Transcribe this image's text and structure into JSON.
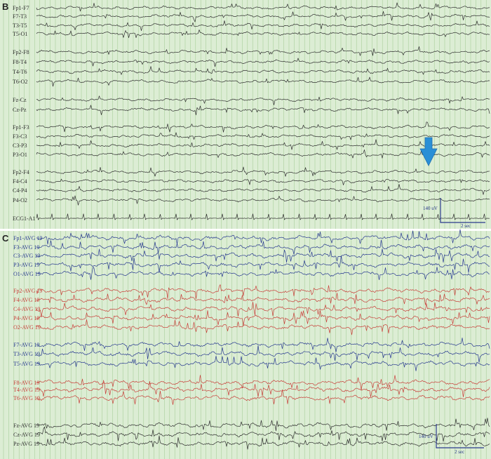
{
  "panels": [
    {
      "letter": "B",
      "channels": [
        {
          "label": "Fp1-F7",
          "color": "#2f2f2f"
        },
        {
          "label": "F7-T3",
          "color": "#2f2f2f"
        },
        {
          "label": "T3-T5",
          "color": "#2f2f2f"
        },
        {
          "label": "T5-O1",
          "color": "#2f2f2f"
        },
        {
          "label": "Fp2-F8",
          "color": "#2f2f2f"
        },
        {
          "label": "F8-T4",
          "color": "#2f2f2f"
        },
        {
          "label": "T4-T6",
          "color": "#2f2f2f"
        },
        {
          "label": "T6-O2",
          "color": "#2f2f2f"
        },
        {
          "label": "Fz-Cz",
          "color": "#2f2f2f"
        },
        {
          "label": "Cz-Pz",
          "color": "#2f2f2f"
        },
        {
          "label": "Fp1-F3",
          "color": "#2f2f2f"
        },
        {
          "label": "F3-C3",
          "color": "#2f2f2f"
        },
        {
          "label": "C3-P3",
          "color": "#2f2f2f"
        },
        {
          "label": "P3-O1",
          "color": "#2f2f2f"
        },
        {
          "label": "Fp2-F4",
          "color": "#2f2f2f"
        },
        {
          "label": "F4-C4",
          "color": "#2f2f2f"
        },
        {
          "label": "C4-P4",
          "color": "#2f2f2f"
        },
        {
          "label": "P4-O2",
          "color": "#2f2f2f"
        },
        {
          "label": "ECG1-A1",
          "color": "#2f2f2f"
        }
      ],
      "scale": {
        "amplitude": "140 uV",
        "time": "2 sec",
        "color": "#2a3a8c"
      },
      "arrow_color": "#2a8fd6"
    },
    {
      "letter": "C",
      "channels": [
        {
          "label": "Fp1-AVG 19",
          "color": "#283a90"
        },
        {
          "label": "F3-AVG 19",
          "color": "#283a90"
        },
        {
          "label": "C3-AVG 19",
          "color": "#283a90"
        },
        {
          "label": "P3-AVG 19",
          "color": "#283a90"
        },
        {
          "label": "O1-AVG 19",
          "color": "#283a90"
        },
        {
          "label": "Fp2-AVG 19",
          "color": "#c8403a"
        },
        {
          "label": "F4-AVG 19",
          "color": "#c8403a"
        },
        {
          "label": "C4-AVG 19",
          "color": "#c8403a"
        },
        {
          "label": "P4-AVG 19",
          "color": "#c8403a"
        },
        {
          "label": "O2-AVG 19",
          "color": "#c8403a"
        },
        {
          "label": "F7-AVG 19",
          "color": "#283a90"
        },
        {
          "label": "T3-AVG 19",
          "color": "#283a90"
        },
        {
          "label": "T5-AVG 19",
          "color": "#283a90"
        },
        {
          "label": "F8-AVG 19",
          "color": "#c8403a"
        },
        {
          "label": "T4-AVG 19",
          "color": "#c8403a"
        },
        {
          "label": "T6-AVG 19",
          "color": "#c8403a"
        },
        {
          "label": "Fz-AVG 19",
          "color": "#2f2f2f"
        },
        {
          "label": "Cz-AVG 19",
          "color": "#2f2f2f"
        },
        {
          "label": "Pz-AVG 19",
          "color": "#2f2f2f"
        }
      ],
      "scale": {
        "amplitude": "140 uV",
        "time": "2 sec",
        "color": "#2a3a8c"
      }
    }
  ],
  "colors": {
    "background": "#dcedd4",
    "gridline": "#9fc98f"
  }
}
